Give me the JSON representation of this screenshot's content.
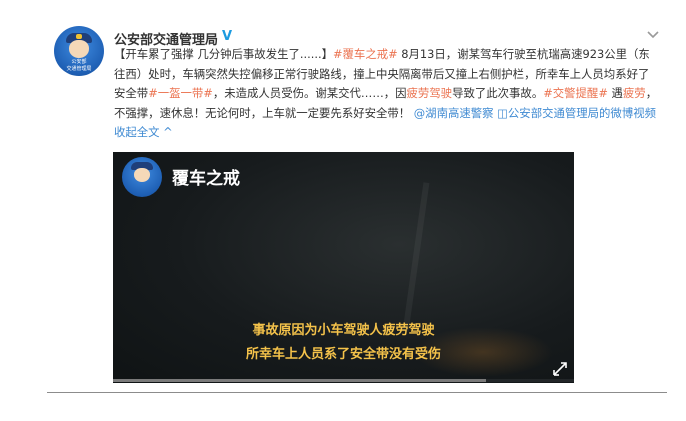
{
  "account": {
    "name": "公安部交通管理局",
    "verified_mark": "V",
    "avatar_lines": [
      "公安部",
      "交通管理局"
    ]
  },
  "post": {
    "p1": "【开车累了强撑 几分钟后事故发生了......】",
    "tag1": "#覆车之戒#",
    "p2": " 8月13日，谢某驾车行驶至杭瑞高速923公里（东往西）处时，车辆突然失控偏移正常行驶路线，撞上中央隔离带后又撞上右侧护栏，所幸车上人员均系好了安全带",
    "tag2": "#一盔一带#",
    "p3": "，未造成人员受伤。谢某交代……，因",
    "kw1": "疲劳驾驶",
    "p4": "导致了此次事故。",
    "tag3": "#交警提醒#",
    "p5": " 遇",
    "kw2": "疲劳",
    "p6": "，不强撑，速休息！无论何时，上车就一定要先系好安全带！ ",
    "mention": "@湖南高速警察",
    "video_link": " ◫公安部交通管理局的微博视频",
    "more": " 收起全文 ^"
  },
  "video": {
    "title": "覆车之戒",
    "subtitle1": "事故原因为小车驾驶人疲劳驾驶",
    "subtitle2": "所幸车上人员系了安全带没有受伤",
    "progress": 0.81
  },
  "icons": {
    "collapse": "chevron-down-icon",
    "fullscreen": "fullscreen-icon",
    "verified": "verified-icon"
  },
  "colors": {
    "link": "#eb7350",
    "blue_link": "#3f8ad2",
    "verified": "#1d9be0",
    "subtitle": "#f4c24a"
  }
}
